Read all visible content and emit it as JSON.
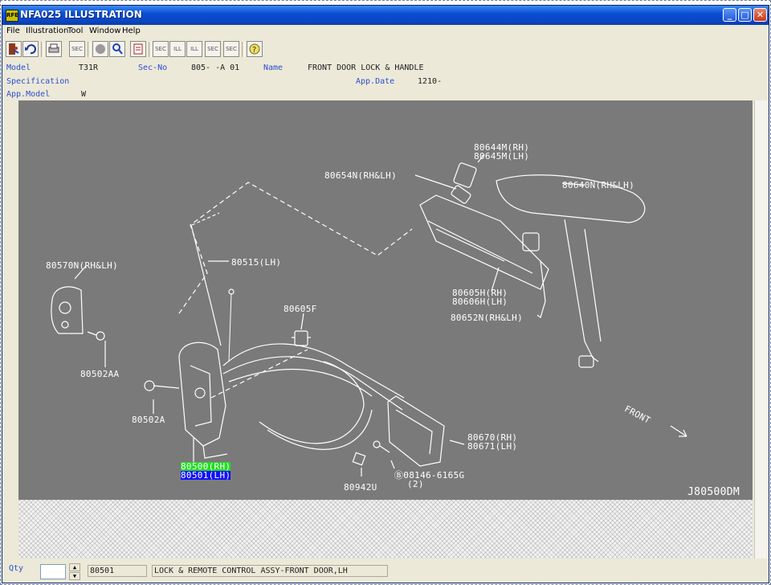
{
  "window": {
    "title": "NFA025  ILLUSTRATION",
    "app_icon_text": "RFE",
    "controls": {
      "minimize": "_",
      "maximize": "□",
      "close": "✕"
    }
  },
  "menu": {
    "items": [
      "File",
      "Illustration",
      "Tool",
      "Window",
      "Help"
    ]
  },
  "toolbar": {
    "buttons": [
      "exit",
      "undo",
      "print",
      "sec-search",
      "circle",
      "zoom",
      "notes",
      "sec-prev",
      "ill-prev",
      "ill-next",
      "sec-next",
      "sec-query",
      "help"
    ],
    "labels": {
      "sec": "SEC",
      "ill": "ILL"
    }
  },
  "info": {
    "model_label": "Model",
    "model_value": "T31R",
    "secno_label": "Sec-No",
    "secno_value": "805-  -A 01",
    "name_label": "Name",
    "name_value": "FRONT DOOR LOCK & HANDLE",
    "spec_label": "Specification",
    "appdate_label": "App.Date",
    "appdate_value": "1210-",
    "appmodel_label": "App.Model",
    "appmodel_value": "W"
  },
  "illustration": {
    "callouts": {
      "c80644m": "80644M(RH)",
      "c80645m": "80645M(LH)",
      "c80654n": "80654N(RH&LH)",
      "c80640n": "80640N(RH&LH)",
      "c80570n": "80570N(RH&LH)",
      "c80515": "80515(LH)",
      "c80605h": "80605H(RH)",
      "c80606h": "80606H(LH)",
      "c80652n": "80652N(RH&LH)",
      "c80605f": "80605F",
      "c80502aa": "80502AA",
      "c80502a": "80502A",
      "c80500": "80500(RH)",
      "c80501": "80501(LH)",
      "c80670": "80670(RH)",
      "c80671": "80671(LH)",
      "c08146": "Ⓑ08146-6165G",
      "c08146qty": "(2)",
      "c80942u": "80942U",
      "front": "FRONT",
      "diagram_id": "J80500DM"
    }
  },
  "status": {
    "qty_label": "Qty",
    "qty_value": "",
    "part_no": "80501",
    "part_name": "LOCK & REMOTE CONTROL ASSY-FRONT DOOR,LH"
  }
}
